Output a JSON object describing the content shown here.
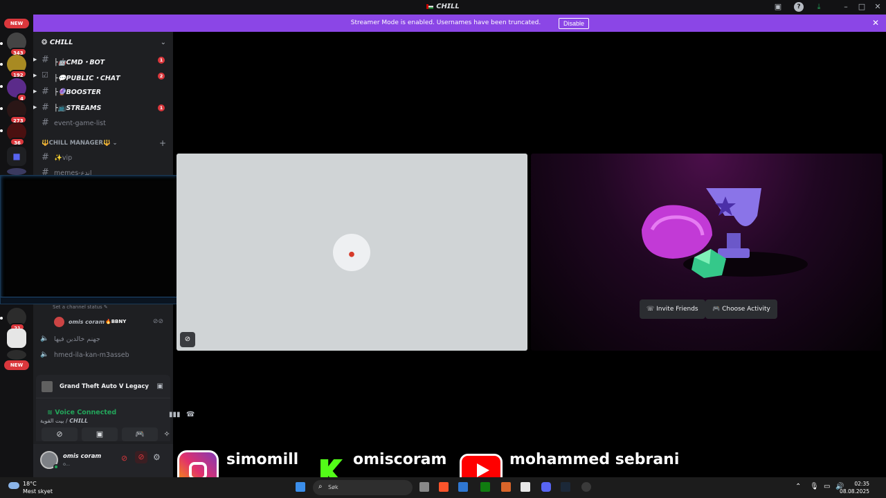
{
  "window": {
    "title": "𝘾𝙃𝙄𝙇𝙇"
  },
  "banner": {
    "message": "Streamer Mode is enabled. Usernames have been truncated.",
    "disable_label": "Disable"
  },
  "rail": {
    "new_label_top": "NEW",
    "new_label_bottom": "NEW",
    "badges": [
      "343",
      "192",
      "4",
      "273",
      "36",
      "21"
    ]
  },
  "guild": {
    "name": "𝘾𝙃𝙄𝙇𝙇"
  },
  "channels": [
    {
      "name": "├🤖𝘾𝙈𝘿・𝘽𝙊𝙏",
      "count": "1"
    },
    {
      "name": "├💬𝙋𝙐𝘽𝙇𝙄𝘾・𝘾𝙃𝘼𝙏",
      "count": "2"
    },
    {
      "name": "├🔮𝘽𝙊𝙊𝙎𝙏𝙀𝙍",
      "count": ""
    },
    {
      "name": "├📺𝙎𝙏𝙍𝙀𝘼𝙈𝙎",
      "count": "1"
    },
    {
      "name": "event-game-list",
      "count": ""
    }
  ],
  "category": {
    "name": "🔱CHILL MANAGER🔱"
  },
  "channels2": [
    {
      "name": "✨vip"
    },
    {
      "name": "memes-اندع"
    }
  ],
  "voice": {
    "status_placeholder": "Set a channel status ✎",
    "user_name": "omis coram",
    "user_tag": "🔥BBNY",
    "channel1": "جهنم خالدين فيها",
    "channel2": "hmed-ila-kan-m3asseb"
  },
  "panel": {
    "game": "Grand Theft Auto V Legacy",
    "connected": "Voice Connected",
    "location": "بيت القوية / 𝘾𝙃𝙄𝙇𝙇"
  },
  "user": {
    "name": "omis coram",
    "status": "o..."
  },
  "stage": {
    "invite_label": "Invite Friends",
    "activity_label": "Choose Activity"
  },
  "socials": {
    "instagram": "simomill",
    "kick": "omiscoram",
    "youtube": "mohammed sebrani"
  },
  "taskbar": {
    "temp": "18°C",
    "weather": "Mest skyet",
    "search_placeholder": "Søk",
    "time": "02:35",
    "date": "08.08.2025"
  },
  "colors": {
    "accent": "#8b46e6",
    "danger": "#da373c",
    "online": "#23a55a"
  }
}
